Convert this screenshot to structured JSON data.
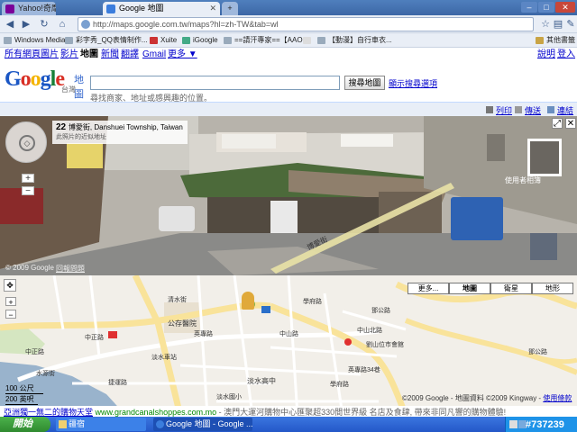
{
  "tabs": [
    {
      "label": "Yahoo!奇摩",
      "active": false
    },
    {
      "label": "Google 地圖",
      "active": true
    }
  ],
  "window_controls": {
    "minimize": "–",
    "maximize": "□",
    "close": "✕"
  },
  "address": {
    "url": "http://maps.google.com.tw/maps?hl=zh-TW&tab=wl"
  },
  "bookmarks": {
    "items": [
      "Windows Media",
      "彩字秀_QQ表情制作...",
      "Xuite",
      "iGoogle",
      "==請汗專家==【AAO...",
      "",
      "【動漫】自行車衣..."
    ],
    "other": "其他書籤"
  },
  "google_nav": {
    "links": [
      "所有網頁",
      "圖片",
      "影片",
      "地圖",
      "新聞",
      "翻譯",
      "Gmail",
      "更多 ▼"
    ],
    "current": "地圖",
    "right": [
      "說明",
      "登入"
    ]
  },
  "brand": {
    "logo": "Google",
    "product": "地圖",
    "region": "台灣"
  },
  "search": {
    "value": "",
    "button": "搜尋地圖",
    "options_link": "顯示搜尋選項",
    "hint": "尋找商家、地址或感興趣的位置。"
  },
  "toolstrip": {
    "print": "列印",
    "send": "傳送",
    "link": "連結"
  },
  "street_view": {
    "address_num": "22",
    "address_street": "博愛街, Danshuei Township, Taiwan",
    "address_sub": "此照片的近似地址",
    "copyright": "© 2009 Google",
    "report": "回報問題",
    "user_photos": "使用者相簿",
    "road_label": "博愛街"
  },
  "map": {
    "map_types": [
      "更多...",
      "地圖",
      "衛星",
      "地形"
    ],
    "active_type": "地圖",
    "scale": [
      "100 公尺",
      "200 英呎"
    ],
    "copyright": "©2009 Google - 地圖資料 ©2009 Kingway -",
    "terms": "使用條款",
    "labels": [
      "清水街",
      "公存醫院",
      "英專路",
      "中正路",
      "學府路",
      "中山路",
      "淡水高中",
      "淡水車站",
      "淡水國小",
      "中正路",
      "水源街",
      "劉山位市會館",
      "英專路34巷",
      "中山北路",
      "鄧公路",
      "鄧公路",
      "學府路",
      "捷運路"
    ]
  },
  "ad": {
    "title": "亞洲獨一無二的購物天堂",
    "url": "www.grandcanalshoppes.com.mo",
    "text": " - 澳門大運河購物中心匯聚超330間世界級 名店及食肆, 帶來非同凡響的購物體驗!"
  },
  "taskbar": {
    "start": "開始",
    "tasks": [
      "Google 地圖 - Google ...",
      "疆宿"
    ],
    "tray_tag": "#737239"
  }
}
